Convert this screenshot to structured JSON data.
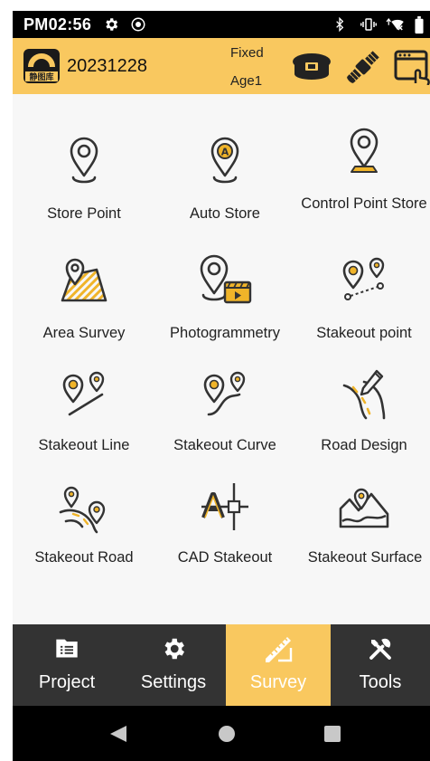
{
  "status_bar": {
    "time": "PM02:56",
    "icons": [
      "settings-icon",
      "location-icon",
      "bluetooth-icon",
      "vibrate-icon",
      "wifi-off-icon",
      "battery-icon"
    ]
  },
  "header": {
    "logo_text": "静图库",
    "project_name": "20231228",
    "fix_status": "Fixed",
    "age": "Age1",
    "icons": [
      "gnss-receiver-icon",
      "satellite-icon",
      "device-config-icon"
    ]
  },
  "grid": {
    "items": [
      {
        "label": "Store Point",
        "icon": "store-point-icon"
      },
      {
        "label": "Auto Store",
        "icon": "auto-store-icon"
      },
      {
        "label": "Control Point Store",
        "icon": "control-point-store-icon"
      },
      {
        "label": "Area Survey",
        "icon": "area-survey-icon"
      },
      {
        "label": "Photogrammetry",
        "icon": "photogrammetry-icon"
      },
      {
        "label": "Stakeout point",
        "icon": "stakeout-point-icon"
      },
      {
        "label": "Stakeout Line",
        "icon": "stakeout-line-icon"
      },
      {
        "label": "Stakeout Curve",
        "icon": "stakeout-curve-icon"
      },
      {
        "label": "Road Design",
        "icon": "road-design-icon"
      },
      {
        "label": "Stakeout Road",
        "icon": "stakeout-road-icon"
      },
      {
        "label": "CAD Stakeout",
        "icon": "cad-stakeout-icon"
      },
      {
        "label": "Stakeout Surface",
        "icon": "stakeout-surface-icon"
      }
    ]
  },
  "bottom_nav": {
    "items": [
      {
        "label": "Project",
        "icon": "project-icon",
        "active": false
      },
      {
        "label": "Settings",
        "icon": "settings-icon",
        "active": false
      },
      {
        "label": "Survey",
        "icon": "survey-icon",
        "active": true
      },
      {
        "label": "Tools",
        "icon": "tools-icon",
        "active": false
      }
    ]
  },
  "system_nav": [
    "back-icon",
    "home-icon",
    "recents-icon"
  ],
  "colors": {
    "accent": "#f9c85f",
    "header_bg": "#f9c85f",
    "nav_bg": "#333333",
    "icon_stroke": "#333333",
    "icon_fill_accent": "#f0b429"
  }
}
